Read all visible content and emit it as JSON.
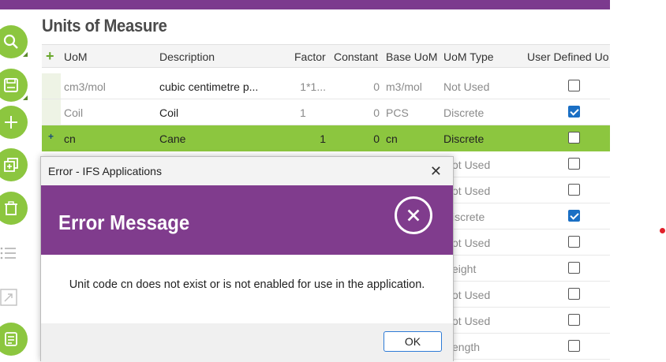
{
  "page": {
    "title": "Units of Measure"
  },
  "grid": {
    "columns": [
      "UoM",
      "Description",
      "Factor",
      "Constant",
      "Base UoM",
      "UoM Type",
      "User Defined Uo"
    ],
    "rows": [
      {
        "uom": "cm3/mol",
        "description": "cubic centimetre p...",
        "factor": "1*1...",
        "constant": "0",
        "base": "m3/mol",
        "type": "Not Used",
        "user_defined": false
      },
      {
        "uom": "Coil",
        "description": "Coil",
        "factor": "1",
        "constant": "0",
        "base": "PCS",
        "type": "Discrete",
        "user_defined": true
      },
      {
        "uom": "cn",
        "description": "Cane",
        "factor": "1",
        "constant": "0",
        "base": "cn",
        "type": "Discrete",
        "user_defined": false
      },
      {
        "type": "ot Used",
        "user_defined": false
      },
      {
        "type": "ot Used",
        "user_defined": false
      },
      {
        "type": "iscrete",
        "user_defined": true
      },
      {
        "type": "ot Used",
        "user_defined": false
      },
      {
        "type": "eight",
        "user_defined": false
      },
      {
        "type": "ot Used",
        "user_defined": false
      },
      {
        "type": "ot Used",
        "user_defined": false
      },
      {
        "type": "ength",
        "user_defined": false
      }
    ]
  },
  "dialog": {
    "window_title": "Error - IFS Applications",
    "heading": "Error Message",
    "message": "Unit code cn does not exist or is not enabled for use in the application.",
    "ok_label": "OK"
  },
  "colors": {
    "brand_purple": "#803c8d",
    "accent_green": "#8cc63f",
    "checkbox_blue": "#1a6fc4"
  },
  "icons": [
    "search-icon",
    "save-icon",
    "add-icon",
    "duplicate-icon",
    "delete-icon",
    "list-icon",
    "expand-icon",
    "details-icon",
    "close-icon",
    "error-circle-icon"
  ]
}
